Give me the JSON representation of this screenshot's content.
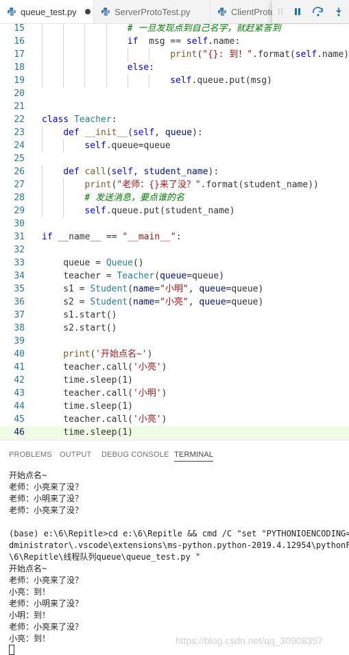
{
  "tabs": [
    {
      "label": "queue_test.py",
      "active": true,
      "dirty": true,
      "icon": "python-icon"
    },
    {
      "label": "ServerProtoTest.py",
      "active": false,
      "icon": "python-icon"
    },
    {
      "label": "ClientProto",
      "active": false,
      "icon": "python-icon"
    }
  ],
  "debug_toolbar": {
    "icons": [
      "drag-grip-icon",
      "pause-icon",
      "step-over-icon",
      "step-into-icon"
    ]
  },
  "editor": {
    "current_line": 46,
    "lines": [
      {
        "n": "15",
        "tokens": [
          [
            "cmt",
            "# 一旦发现点到自己名字，就赶紧答到"
          ]
        ]
      },
      {
        "n": "16",
        "tokens": [
          [
            "kw",
            "if"
          ],
          [
            "",
            "  msg == "
          ],
          [
            "slf",
            "self"
          ],
          [
            "",
            ".name:"
          ]
        ]
      },
      {
        "n": "17",
        "tokens": [
          [
            "fn",
            "print"
          ],
          [
            "",
            "("
          ],
          [
            "str",
            "\"{}: 到！\""
          ],
          [
            "",
            ".format("
          ],
          [
            "slf",
            "self"
          ],
          [
            "",
            ".name))"
          ]
        ]
      },
      {
        "n": "18",
        "tokens": [
          [
            "kw",
            "else"
          ],
          [
            "",
            ":"
          ]
        ]
      },
      {
        "n": "19",
        "tokens": [
          [
            "slf",
            "self"
          ],
          [
            "",
            ".queue.put(msg)"
          ]
        ]
      },
      {
        "n": "20",
        "tokens": []
      },
      {
        "n": "21",
        "tokens": []
      },
      {
        "n": "22",
        "tokens": [
          [
            "kw",
            "class"
          ],
          [
            "",
            " "
          ],
          [
            "cls",
            "Teacher"
          ],
          [
            "",
            ":"
          ]
        ]
      },
      {
        "n": "23",
        "tokens": [
          [
            "kw",
            "def"
          ],
          [
            "",
            " "
          ],
          [
            "fn",
            "__init__"
          ],
          [
            "",
            "("
          ],
          [
            "slf",
            "self"
          ],
          [
            "",
            ", "
          ],
          [
            "prm",
            "queue"
          ],
          [
            "",
            "):"
          ]
        ]
      },
      {
        "n": "24",
        "tokens": [
          [
            "slf",
            "self"
          ],
          [
            "",
            ".queue=queue"
          ]
        ]
      },
      {
        "n": "25",
        "tokens": []
      },
      {
        "n": "26",
        "tokens": [
          [
            "kw",
            "def"
          ],
          [
            "",
            " "
          ],
          [
            "fn",
            "call"
          ],
          [
            "",
            "("
          ],
          [
            "slf",
            "self"
          ],
          [
            "",
            ", "
          ],
          [
            "prm",
            "student_name"
          ],
          [
            "",
            "):"
          ]
        ]
      },
      {
        "n": "27",
        "tokens": [
          [
            "fn",
            "print"
          ],
          [
            "",
            "("
          ],
          [
            "str",
            "\"老师：{}来了没？\""
          ],
          [
            "",
            ".format(student_name))"
          ]
        ]
      },
      {
        "n": "28",
        "tokens": [
          [
            "cmt",
            "# 发送消息，要点谁的名"
          ]
        ]
      },
      {
        "n": "29",
        "tokens": [
          [
            "slf",
            "self"
          ],
          [
            "",
            ".queue.put(student_name)"
          ]
        ]
      },
      {
        "n": "30",
        "tokens": []
      },
      {
        "n": "31",
        "tokens": [
          [
            "kw",
            "if"
          ],
          [
            "",
            " __name__ == "
          ],
          [
            "str",
            "\"__main__\""
          ],
          [
            "",
            ":"
          ]
        ]
      },
      {
        "n": "32",
        "tokens": []
      },
      {
        "n": "33",
        "tokens": [
          [
            "",
            "queue = "
          ],
          [
            "cls",
            "Queue"
          ],
          [
            "",
            "()"
          ]
        ]
      },
      {
        "n": "34",
        "tokens": [
          [
            "",
            "teacher = "
          ],
          [
            "cls",
            "Teacher"
          ],
          [
            "",
            "("
          ],
          [
            "prm",
            "queue"
          ],
          [
            "",
            "=queue)"
          ]
        ]
      },
      {
        "n": "35",
        "tokens": [
          [
            "",
            "s1 = "
          ],
          [
            "cls",
            "Student"
          ],
          [
            "",
            "("
          ],
          [
            "prm",
            "name"
          ],
          [
            "",
            "="
          ],
          [
            "str",
            "\"小明\""
          ],
          [
            "",
            ", "
          ],
          [
            "prm",
            "queue"
          ],
          [
            "",
            "=queue)"
          ]
        ]
      },
      {
        "n": "36",
        "tokens": [
          [
            "",
            "s2 = "
          ],
          [
            "cls",
            "Student"
          ],
          [
            "",
            "("
          ],
          [
            "prm",
            "name"
          ],
          [
            "",
            "="
          ],
          [
            "str",
            "\"小亮\""
          ],
          [
            "",
            ", "
          ],
          [
            "prm",
            "queue"
          ],
          [
            "",
            "=queue)"
          ]
        ]
      },
      {
        "n": "37",
        "tokens": [
          [
            "",
            "s1.start()"
          ]
        ]
      },
      {
        "n": "38",
        "tokens": [
          [
            "",
            "s2.start()"
          ]
        ]
      },
      {
        "n": "39",
        "tokens": []
      },
      {
        "n": "40",
        "tokens": [
          [
            "fn",
            "print"
          ],
          [
            "",
            "("
          ],
          [
            "str",
            "'开始点名~'"
          ],
          [
            "",
            ")"
          ]
        ]
      },
      {
        "n": "41",
        "tokens": [
          [
            "",
            "teacher.call("
          ],
          [
            "str",
            "'小亮'"
          ],
          [
            "",
            ")"
          ]
        ]
      },
      {
        "n": "42",
        "tokens": [
          [
            "",
            "time.sleep(1)"
          ]
        ]
      },
      {
        "n": "43",
        "tokens": [
          [
            "",
            "teacher.call("
          ],
          [
            "str",
            "'小明'"
          ],
          [
            "",
            ")"
          ]
        ]
      },
      {
        "n": "44",
        "tokens": [
          [
            "",
            "time.sleep(1)"
          ]
        ]
      },
      {
        "n": "45",
        "tokens": [
          [
            "",
            "teacher.call("
          ],
          [
            "str",
            "'小亮'"
          ],
          [
            "",
            ")"
          ]
        ]
      },
      {
        "n": "46",
        "tokens": [
          [
            "",
            "time.sleep(1)"
          ]
        ]
      }
    ]
  },
  "panel": {
    "tabs": [
      {
        "label": "PROBLEMS",
        "active": false
      },
      {
        "label": "OUTPUT",
        "active": false
      },
      {
        "label": "DEBUG CONSOLE",
        "active": false
      },
      {
        "label": "TERMINAL",
        "active": true
      }
    ],
    "terminal_lines": [
      "开始点名~",
      "老师：小亮来了没？",
      "老师：小明来了没？",
      "老师：小亮来了没？",
      "",
      "(base) e:\\6\\Repitle>cd e:\\6\\Repitle && cmd /C \"set \"PYTHONIOENCODING=UTF",
      "dministrator\\.vscode\\extensions\\ms-python.python-2019.4.12954\\pythonFil",
      "\\6\\Repitle\\线程队列queue\\queue_test.py \"",
      "开始点名~",
      "老师：小亮来了没？",
      "小亮：到！",
      "老师：小明来了没？",
      "小明：到！",
      "老师：小亮来了没？",
      "小亮：到！"
    ],
    "watermark": "https://blog.csdn.net/qq_30908357"
  }
}
